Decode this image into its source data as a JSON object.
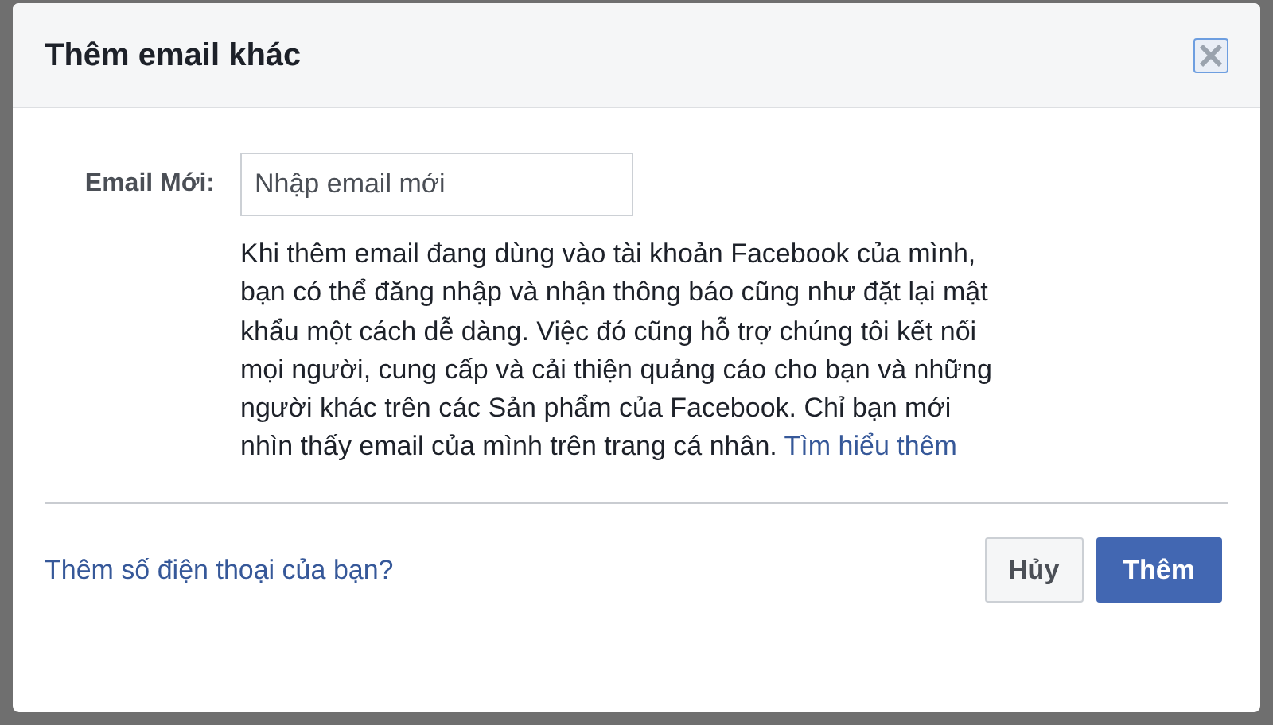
{
  "dialog": {
    "title": "Thêm email khác",
    "field": {
      "label": "Email Mới:",
      "placeholder": "Nhập email mới"
    },
    "description": "Khi thêm email đang dùng vào tài khoản Facebook của mình, bạn có thể đăng nhập và nhận thông báo cũng như đặt lại mật khẩu một cách dễ dàng. Việc đó cũng hỗ trợ chúng tôi kết nối mọi người, cung cấp và cải thiện quảng cáo cho bạn và những người khác trên các Sản phẩm của Facebook. Chỉ bạn mới nhìn thấy email của mình trên trang cá nhân.",
    "learn_more_link": "Tìm hiểu thêm",
    "footer_link": "Thêm số điện thoại của bạn?",
    "buttons": [
      {
        "label": "Hủy",
        "kind": "secondary"
      },
      {
        "label": "Thêm",
        "kind": "primary"
      }
    ]
  }
}
